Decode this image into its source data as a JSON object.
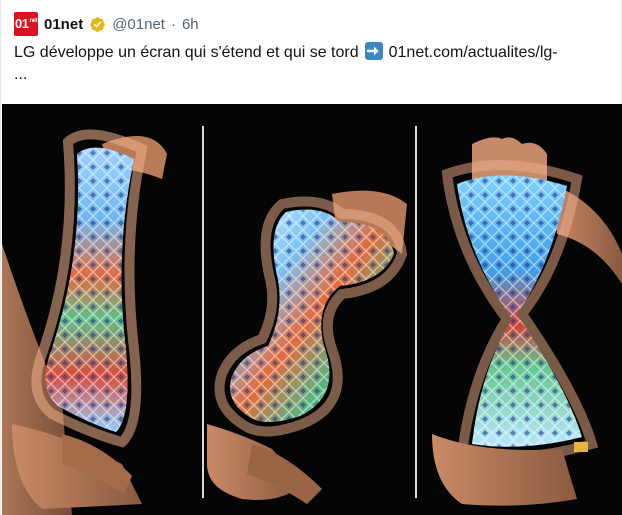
{
  "tweet": {
    "display_name": "01net",
    "avatar_text": "01",
    "avatar_sup": "net",
    "handle": "@01net",
    "separator": "·",
    "time": "6h",
    "text_main": "LG développe un écran qui s'étend et qui se tord",
    "link_text": "01net.com/actualites/lg-",
    "ellipsis": "..."
  },
  "icons": {
    "verified": "verified-gold-badge-icon",
    "arrow": "right-arrow-emoji-icon"
  },
  "colors": {
    "avatar_bg": "#e10f1f",
    "verified_gold": "#e2b719",
    "arrow_emoji_bg": "#3b88c3",
    "text": "#0f1419",
    "muted": "#536471"
  },
  "media": {
    "panels": [
      {
        "label": ""
      },
      {
        "label": ""
      },
      {
        "label": ""
      }
    ]
  }
}
